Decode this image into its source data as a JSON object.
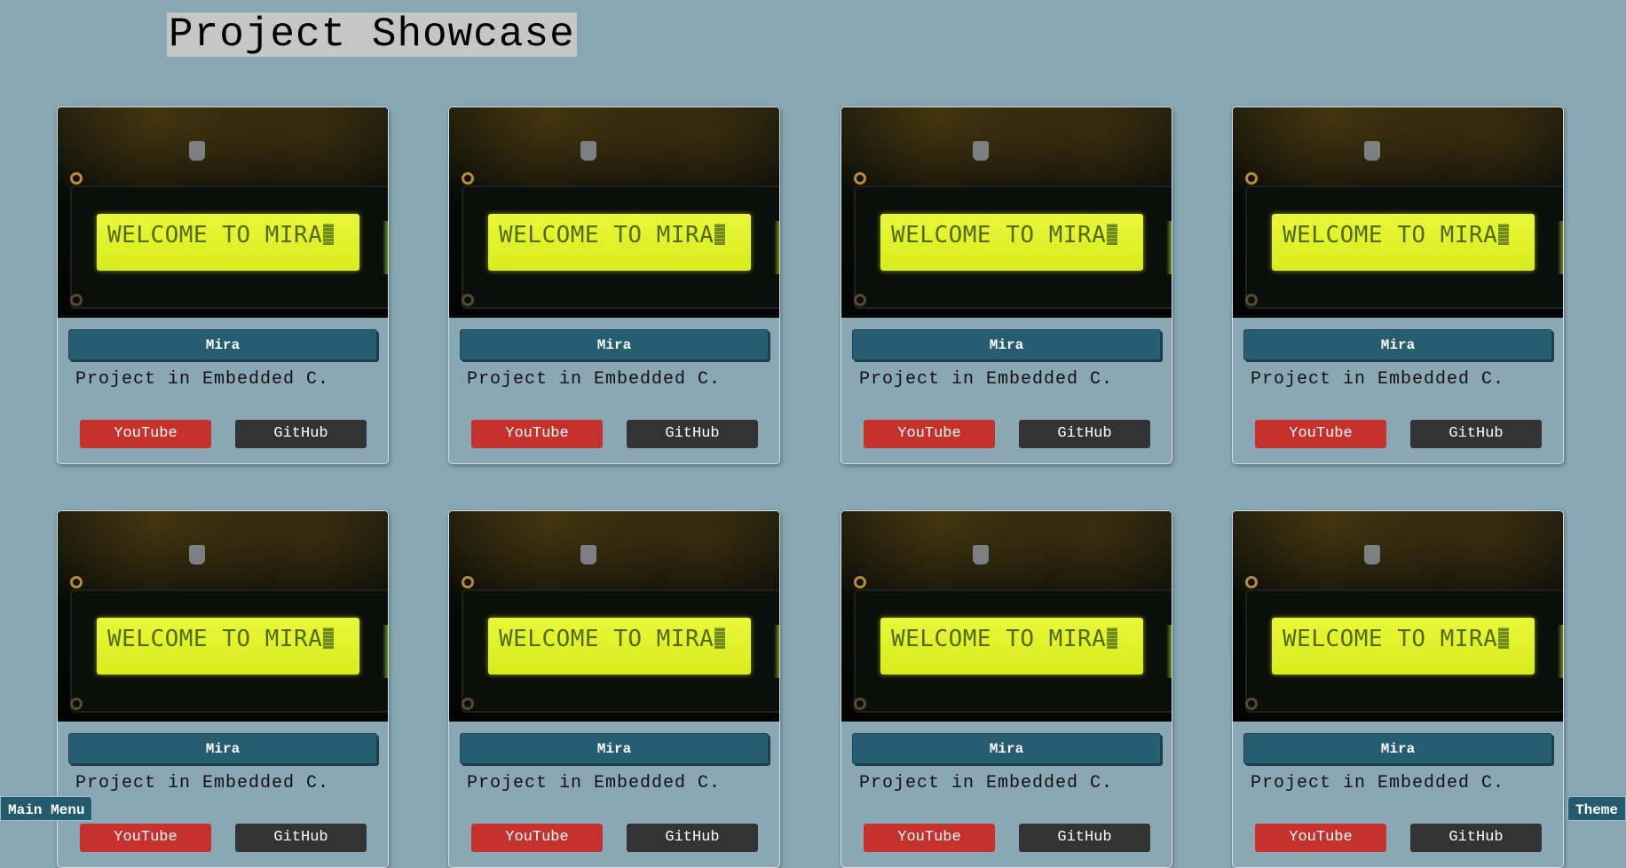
{
  "page": {
    "title": "Project Showcase"
  },
  "projects": [
    {
      "name": "Mira",
      "description": "Project in Embedded C.",
      "youtube_label": "YouTube",
      "github_label": "GitHub",
      "lcd_text": "WELCOME TO MIRA"
    },
    {
      "name": "Mira",
      "description": "Project in Embedded C.",
      "youtube_label": "YouTube",
      "github_label": "GitHub",
      "lcd_text": "WELCOME TO MIRA"
    },
    {
      "name": "Mira",
      "description": "Project in Embedded C.",
      "youtube_label": "YouTube",
      "github_label": "GitHub",
      "lcd_text": "WELCOME TO MIRA"
    },
    {
      "name": "Mira",
      "description": "Project in Embedded C.",
      "youtube_label": "YouTube",
      "github_label": "GitHub",
      "lcd_text": "WELCOME TO MIRA"
    },
    {
      "name": "Mira",
      "description": "Project in Embedded C.",
      "youtube_label": "YouTube",
      "github_label": "GitHub",
      "lcd_text": "WELCOME TO MIRA"
    },
    {
      "name": "Mira",
      "description": "Project in Embedded C.",
      "youtube_label": "YouTube",
      "github_label": "GitHub",
      "lcd_text": "WELCOME TO MIRA"
    },
    {
      "name": "Mira",
      "description": "Project in Embedded C.",
      "youtube_label": "YouTube",
      "github_label": "GitHub",
      "lcd_text": "WELCOME TO MIRA"
    },
    {
      "name": "Mira",
      "description": "Project in Embedded C.",
      "youtube_label": "YouTube",
      "github_label": "GitHub",
      "lcd_text": "WELCOME TO MIRA"
    }
  ],
  "footer": {
    "main_menu_label": "Main Menu",
    "theme_label": "Theme"
  },
  "colors": {
    "background": "#87a7b3",
    "name_button": "#265d70",
    "youtube_button": "#c5312c",
    "github_button": "#333333",
    "lcd_screen": "#e3f52e"
  }
}
